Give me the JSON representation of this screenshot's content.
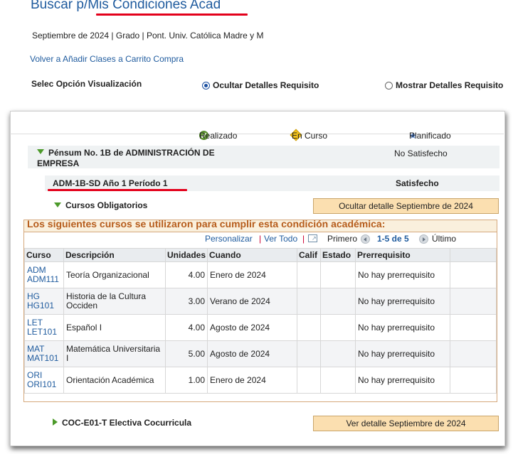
{
  "header": {
    "title": "Buscar p/Mis Condiciones Acad",
    "term_line": "Septiembre de 2024 | Grado | Pont. Univ. Católica Madre y M",
    "back_link": "Volver a Añadir Clases a Carrito Compra"
  },
  "view_options": {
    "label": "Selec Opción Visualización",
    "hide": "Ocultar Detalles Requisito",
    "show": "Mostrar Detalles Requisito"
  },
  "legend": {
    "done": "Realizado",
    "in_progress": "En Curso",
    "planned": "Planificado"
  },
  "requirement": {
    "title": "Pénsum No. 1B de ADMINISTRACIÓN DE EMPRESA",
    "status": "No Satisfecho"
  },
  "subreq": {
    "title": "ADM-1B-SD Año 1 Período 1",
    "status": "Satisfecho"
  },
  "line": {
    "title": "Cursos Obligatorios",
    "button": "Ocultar detalle Septiembre de 2024",
    "cond_text": "Los siguientes cursos se utilizaron para cumplir esta condición académica:"
  },
  "grid_nav": {
    "personalize": "Personalizar",
    "sep1": "|",
    "view_all": "Ver Todo",
    "sep2": "|",
    "first": "Primero",
    "range": "1-5 de 5",
    "last": "Último"
  },
  "columns": [
    "Curso",
    "Descripción",
    "Unidades",
    "Cuando",
    "Calif",
    "Estado",
    "Prerrequisito"
  ],
  "courses": [
    {
      "subject": "ADM",
      "code": "ADM111",
      "desc": "Teoría Organizacional",
      "units": "4.00",
      "when": "Enero de 2024",
      "grade": "",
      "status": "",
      "prereq": "No hay prerrequisito"
    },
    {
      "subject": "HG",
      "code": "HG101",
      "desc": "Historia de la Cultura Occiden",
      "units": "3.00",
      "when": "Verano de 2024",
      "grade": "",
      "status": "",
      "prereq": "No hay prerrequisito"
    },
    {
      "subject": "LET",
      "code": "LET101",
      "desc": "Español I",
      "units": "4.00",
      "when": "Agosto de 2024",
      "grade": "",
      "status": "",
      "prereq": "No hay prerrequisito"
    },
    {
      "subject": "MAT",
      "code": "MAT101",
      "desc": "Matemática Universitaria I",
      "units": "5.00",
      "when": "Agosto de 2024",
      "grade": "",
      "status": "",
      "prereq": "No hay prerrequisito"
    },
    {
      "subject": "ORI",
      "code": "ORI101",
      "desc": "Orientación Académica",
      "units": "1.00",
      "when": "Enero de 2024",
      "grade": "",
      "status": "",
      "prereq": "No hay prerrequisito"
    }
  ],
  "elective": {
    "title": "COC-E01-T Electiva Cocurricula",
    "button": "Ver detalle Septiembre de 2024"
  },
  "colors": {
    "link": "#1f5b9e",
    "accent_red": "#e3001b",
    "cond_text": "#b65c1b",
    "button_bg": "#fbdfb0",
    "done_green": "#6aa33a",
    "in_progress_yellow": "#f2c21a",
    "planned_blue": "#3e6db5"
  },
  "icons": [
    "check-circle-icon",
    "diamond-icon",
    "star-icon",
    "triangle-down-icon",
    "triangle-right-icon",
    "radio-selected-icon",
    "radio-empty-icon",
    "view-all-icon",
    "prev-arrow-icon",
    "next-arrow-icon"
  ]
}
